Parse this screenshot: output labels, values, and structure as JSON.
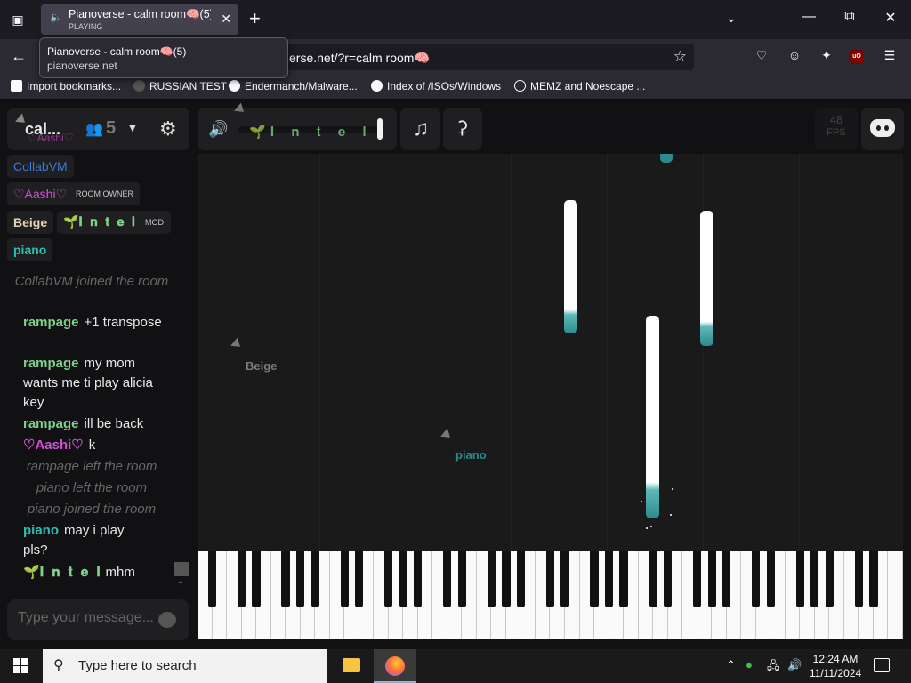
{
  "browser": {
    "tab": {
      "title": "Pianoverse - calm room🧠(5)",
      "status": "PLAYING"
    },
    "tooltip": {
      "title": "Pianoverse - calm room🧠(5)",
      "url": "pianoverse.net"
    },
    "url_visible": "erse.net/?r=calm room🧠",
    "bookmarks": [
      {
        "label": "Import bookmarks..."
      },
      {
        "label": "RUSSIAN TEST"
      },
      {
        "label": "Endermanch/Malware..."
      },
      {
        "label": "Index of /ISOs/Windows"
      },
      {
        "label": "MEMZ and Noescape ..."
      }
    ]
  },
  "app": {
    "room_name": "cal...",
    "user_count": "5",
    "volume_label": "🌱𝐈 𝐧 𝐭 𝐞 𝐥",
    "fps": {
      "value": "48",
      "label": "FPS"
    },
    "colors": {
      "teal": "#2bbfb0",
      "magenta": "#d64fd6",
      "mint": "#7fd18a",
      "beige": "#e6d2b5"
    }
  },
  "users": [
    {
      "name": "♡Aashi♡",
      "color": "#d64fd6",
      "partial": true
    },
    {
      "name": "CollabVM",
      "color": "#3a7bd5"
    },
    {
      "name": "♡Aashi♡",
      "color": "#d64fd6",
      "badge": "ROOM OWNER"
    },
    {
      "name": "Beige",
      "color": "#e6d2b5"
    },
    {
      "name": "🌱𝐈 𝐧 𝐭 𝐞 𝐥",
      "color": "#7fd18a",
      "badge": "MOD"
    },
    {
      "name": "piano",
      "color": "#2bbfb0"
    }
  ],
  "chat": [
    {
      "type": "system",
      "text": "CollabVM joined the room"
    },
    {
      "type": "msg",
      "name": "rampage",
      "color": "#7fd18a",
      "text": "+1 transpose"
    },
    {
      "type": "msg",
      "name": "rampage",
      "color": "#7fd18a",
      "text": "my mom wants me ti play alicia key"
    },
    {
      "type": "msg",
      "name": "rampage",
      "color": "#7fd18a",
      "text": "ill be back"
    },
    {
      "type": "msg",
      "name": "♡Aashi♡",
      "color": "#d64fd6",
      "text": "k"
    },
    {
      "type": "system",
      "text": "rampage left the room"
    },
    {
      "type": "system",
      "text": "piano left the room"
    },
    {
      "type": "system",
      "text": "piano joined the room"
    },
    {
      "type": "msg",
      "name": "piano",
      "color": "#2bbfb0",
      "text": "may i play pls?"
    },
    {
      "type": "msg",
      "name": "🌱𝐈 𝐧 𝐭 𝐞 𝐥",
      "color": "#7fd18a",
      "text": "mhm"
    }
  ],
  "chat_input": {
    "placeholder": "Type your message..."
  },
  "cursors": [
    {
      "name": "Beige",
      "color": "#7a7a7a"
    },
    {
      "name": "piano",
      "color": "#2a8c8c"
    }
  ],
  "taskbar": {
    "search_placeholder": "Type here to search",
    "time": "12:24 AM",
    "date": "11/11/2024"
  }
}
